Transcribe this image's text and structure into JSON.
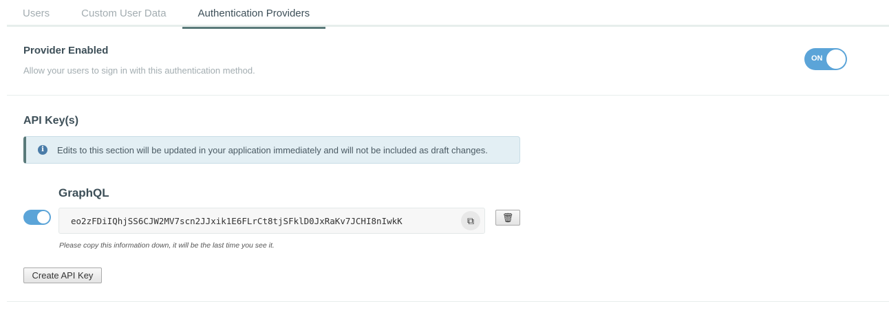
{
  "tabs": [
    {
      "label": "Users"
    },
    {
      "label": "Custom User Data"
    },
    {
      "label": "Authentication Providers",
      "active": true
    }
  ],
  "provider": {
    "title": "Provider Enabled",
    "description": "Allow your users to sign in with this authentication method.",
    "toggle_label": "ON",
    "enabled": true
  },
  "api_keys": {
    "title": "API Key(s)",
    "info": "Edits to this section will be updated in your application immediately and will not be included as draft changes.",
    "info_icon": "i",
    "key": {
      "name": "GraphQL",
      "value": "eo2zFDiIQhjSS6CJW2MV7scn2JJxik1E6FLrCt8tjSFklD0JxRaKv7JCHI8nIwkK",
      "enabled": true,
      "note": "Please copy this information down, it will be the last time you see it."
    },
    "create_label": "Create API Key"
  },
  "colors": {
    "accent": "#5ba4d8",
    "tab_active": "#5a7a7a"
  }
}
